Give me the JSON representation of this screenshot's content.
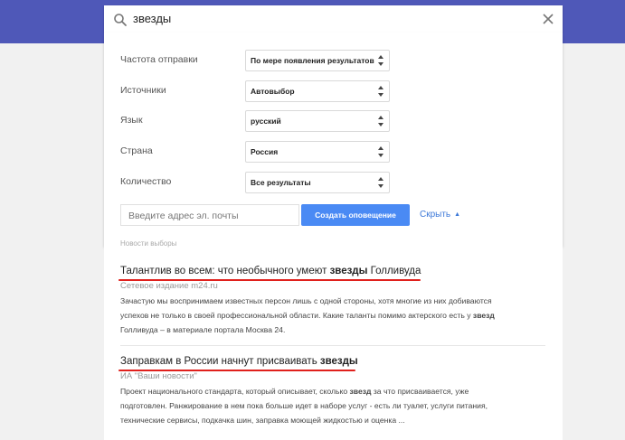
{
  "search": {
    "query": "звезды"
  },
  "options": [
    {
      "label": "Частота отправки",
      "value": "По мере появления результатов"
    },
    {
      "label": "Источники",
      "value": "Автовыбор"
    },
    {
      "label": "Язык",
      "value": "русский"
    },
    {
      "label": "Страна",
      "value": "Россия"
    },
    {
      "label": "Количество",
      "value": "Все результаты"
    }
  ],
  "email": {
    "placeholder": "Введите адрес эл. почты",
    "value": ""
  },
  "buttons": {
    "create": "Создать оповещение",
    "hide": "Скрыть"
  },
  "results": {
    "previous_snippet": "Новости выборы",
    "items": [
      {
        "title_pre": "Талантлив во всем: что необычного умеют ",
        "title_bold": "звезды",
        "title_post": " Голливуда",
        "source": "Сетевое издание m24.ru",
        "snippet_1": "Зачастую мы воспринимаем известных персон лишь с одной стороны, хотя многие из них добиваются",
        "snippet_2_pre": "успехов не только в своей профессиональной области. Какие таланты помимо актерского есть у ",
        "snippet_2_bold": "звезд",
        "snippet_3": "Голливуда – в материале портала Москва 24."
      },
      {
        "title_pre": "Заправкам в России начнут присваивать ",
        "title_bold": "звезды",
        "title_post": "",
        "source": "ИА \"Ваши новости\"",
        "snippet_1_pre": "Проект национального стандарта, который описывает, сколько ",
        "snippet_1_bold": "звезд",
        "snippet_1_post": " за что присваивается, уже",
        "snippet_2": "подготовлен. Ранжирование в нем пока больше идет в наборе услуг - есть ли туалет, услуги питания,",
        "snippet_3": "технические сервисы, подкачка шин, заправка моющей жидкостью и оценка ..."
      }
    ]
  },
  "colors": {
    "topbar": "#4f58b8",
    "button": "#4a8af4",
    "link": "#3c78d8",
    "underline": "#e0201c"
  }
}
